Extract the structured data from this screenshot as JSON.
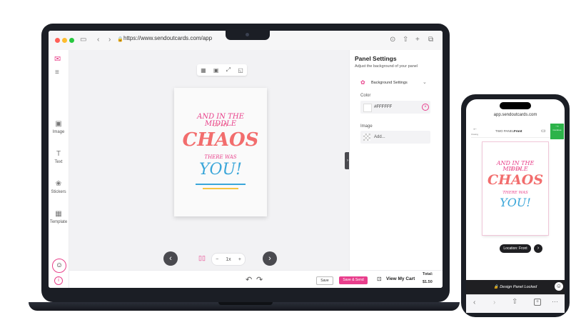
{
  "browser": {
    "url": "https://www.sendoutcards.com/app",
    "traffic_lights": [
      "#ff5f57",
      "#febc2e",
      "#28c840"
    ]
  },
  "sidebar": {
    "items": [
      {
        "label": "Image",
        "icon": "image-icon"
      },
      {
        "label": "Text",
        "icon": "text-icon"
      },
      {
        "label": "Stickers",
        "icon": "sticker-icon"
      },
      {
        "label": "Template",
        "icon": "template-icon"
      }
    ]
  },
  "card": {
    "lines": [
      "AND IN THE MIDDLE",
      "OF MY",
      "CHAOS",
      "THERE WAS",
      "YOU!"
    ]
  },
  "zoom": {
    "value": "1x",
    "minus": "−",
    "plus": "+"
  },
  "footer": {
    "save_label": "Save",
    "save_send_label": "Save & Send",
    "cart_label": "View My Cart",
    "total_label": "Total:",
    "total_value": "$1.50"
  },
  "panel": {
    "title": "Panel Settings",
    "subtitle": "Adjust the background of your panel",
    "background_settings": "Background Settings",
    "color_label": "Color",
    "color_value": "#FFFFFF",
    "image_label": "Image",
    "image_add": "Add..."
  },
  "phone": {
    "url": "app.sendoutcards.com",
    "panel_label": "TWO PANEL:",
    "panel_value": "Front",
    "left_label": "Closing",
    "right_label": "Continue",
    "location_label": "Location:",
    "location_value": "Front",
    "locked_label": "Design Panel Locked"
  },
  "colors": {
    "accent": "#e83e8c",
    "green": "#2db34a",
    "brand": "#e8408a"
  }
}
